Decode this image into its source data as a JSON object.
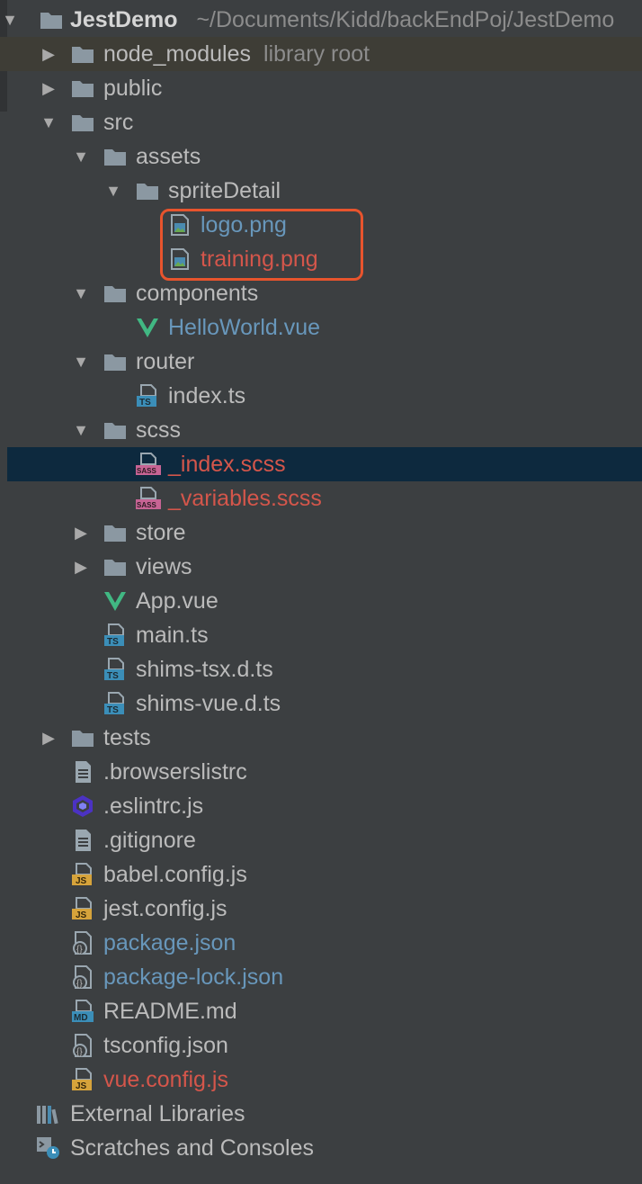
{
  "project": {
    "name": "JestDemo",
    "path": "~/Documents/Kidd/backEndPoj/JestDemo"
  },
  "tree": [
    {
      "label": "node_modules",
      "hint": "library root",
      "depth": 1,
      "arrow": "collapsed",
      "icon": "folder-icon",
      "color": "default"
    },
    {
      "label": "public",
      "depth": 1,
      "arrow": "collapsed",
      "icon": "folder-icon",
      "color": "default"
    },
    {
      "label": "src",
      "depth": 1,
      "arrow": "expanded",
      "icon": "folder-icon",
      "color": "default"
    },
    {
      "label": "assets",
      "depth": 2,
      "arrow": "expanded",
      "icon": "folder-icon",
      "color": "default"
    },
    {
      "label": "spriteDetail",
      "depth": 3,
      "arrow": "expanded",
      "icon": "folder-icon",
      "color": "default"
    },
    {
      "label": "logo.png",
      "depth": 4,
      "arrow": "none",
      "icon": "image-file-icon",
      "color": "blue"
    },
    {
      "label": "training.png",
      "depth": 4,
      "arrow": "none",
      "icon": "image-file-icon",
      "color": "red"
    },
    {
      "label": "components",
      "depth": 2,
      "arrow": "expanded",
      "icon": "folder-icon",
      "color": "default"
    },
    {
      "label": "HelloWorld.vue",
      "depth": 3,
      "arrow": "none",
      "icon": "vue-icon",
      "color": "blue"
    },
    {
      "label": "router",
      "depth": 2,
      "arrow": "expanded",
      "icon": "folder-icon",
      "color": "default"
    },
    {
      "label": "index.ts",
      "depth": 3,
      "arrow": "none",
      "icon": "ts-file-icon",
      "color": "default"
    },
    {
      "label": "scss",
      "depth": 2,
      "arrow": "expanded",
      "icon": "folder-icon",
      "color": "default"
    },
    {
      "label": "_index.scss",
      "depth": 3,
      "arrow": "none",
      "icon": "sass-file-icon",
      "color": "red",
      "selected": true
    },
    {
      "label": "_variables.scss",
      "depth": 3,
      "arrow": "none",
      "icon": "sass-file-icon",
      "color": "red"
    },
    {
      "label": "store",
      "depth": 2,
      "arrow": "collapsed",
      "icon": "folder-icon",
      "color": "default"
    },
    {
      "label": "views",
      "depth": 2,
      "arrow": "collapsed",
      "icon": "folder-icon",
      "color": "default"
    },
    {
      "label": "App.vue",
      "depth": 2,
      "arrow": "none",
      "icon": "vue-icon",
      "color": "default"
    },
    {
      "label": "main.ts",
      "depth": 2,
      "arrow": "none",
      "icon": "ts-file-icon",
      "color": "default"
    },
    {
      "label": "shims-tsx.d.ts",
      "depth": 2,
      "arrow": "none",
      "icon": "ts-file-icon",
      "color": "default"
    },
    {
      "label": "shims-vue.d.ts",
      "depth": 2,
      "arrow": "none",
      "icon": "ts-file-icon",
      "color": "default"
    },
    {
      "label": "tests",
      "depth": 1,
      "arrow": "collapsed",
      "icon": "folder-icon",
      "color": "default"
    },
    {
      "label": ".browserslistrc",
      "depth": 1,
      "arrow": "none",
      "icon": "text-file-icon",
      "color": "default"
    },
    {
      "label": ".eslintrc.js",
      "depth": 1,
      "arrow": "none",
      "icon": "eslint-icon",
      "color": "default"
    },
    {
      "label": ".gitignore",
      "depth": 1,
      "arrow": "none",
      "icon": "text-file-icon",
      "color": "default"
    },
    {
      "label": "babel.config.js",
      "depth": 1,
      "arrow": "none",
      "icon": "js-file-icon",
      "color": "default"
    },
    {
      "label": "jest.config.js",
      "depth": 1,
      "arrow": "none",
      "icon": "js-file-icon",
      "color": "default"
    },
    {
      "label": "package.json",
      "depth": 1,
      "arrow": "none",
      "icon": "json-file-icon",
      "color": "blue"
    },
    {
      "label": "package-lock.json",
      "depth": 1,
      "arrow": "none",
      "icon": "json-file-icon",
      "color": "blue"
    },
    {
      "label": "README.md",
      "depth": 1,
      "arrow": "none",
      "icon": "md-file-icon",
      "color": "default"
    },
    {
      "label": "tsconfig.json",
      "depth": 1,
      "arrow": "none",
      "icon": "json-file-icon",
      "color": "default"
    },
    {
      "label": "vue.config.js",
      "depth": 1,
      "arrow": "none",
      "icon": "js-file-icon",
      "color": "red"
    },
    {
      "label": "External Libraries",
      "depth": 0,
      "arrow": "none",
      "icon": "libraries-icon",
      "color": "default"
    },
    {
      "label": "Scratches and Consoles",
      "depth": 0,
      "arrow": "none",
      "icon": "scratches-icon",
      "color": "default"
    }
  ],
  "colors": {
    "background": "#3c3f41",
    "selection": "#0d293e",
    "modified_blue": "#6897bb",
    "unversioned_red": "#d4564b",
    "annotation_box": "#e8542d",
    "vue_green": "#41b883",
    "ts_blue": "#3b8eb8",
    "js_yellow": "#d6a33b",
    "eslint_purple": "#4b32c3"
  }
}
